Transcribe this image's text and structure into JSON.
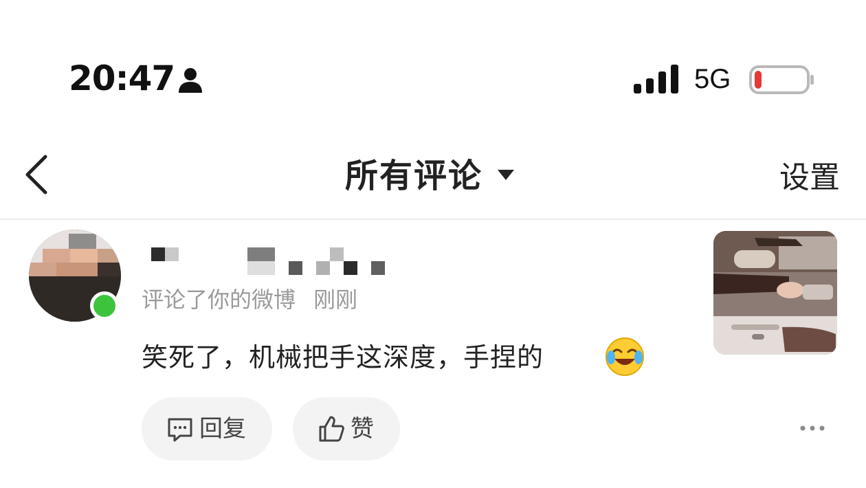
{
  "status_bar": {
    "time": "20:47",
    "network": "5G",
    "icons": [
      "person-icon",
      "signal-icon",
      "battery-icon"
    ],
    "battery_color": "#e53935"
  },
  "nav": {
    "back_icon": "chevron-left-icon",
    "title": "所有评论",
    "dropdown_icon": "caret-down-icon",
    "settings_label": "设置"
  },
  "comment": {
    "meta_action": "评论了你的微博",
    "meta_time": "刚刚",
    "text": "笑死了，机械把手这深度，手捏的",
    "emoji": "rolling-laughing-emoji-icon",
    "online_color": "#3cc43c",
    "reply_label": "回复",
    "like_label": "赞",
    "more_icon": "more-dots-icon"
  }
}
